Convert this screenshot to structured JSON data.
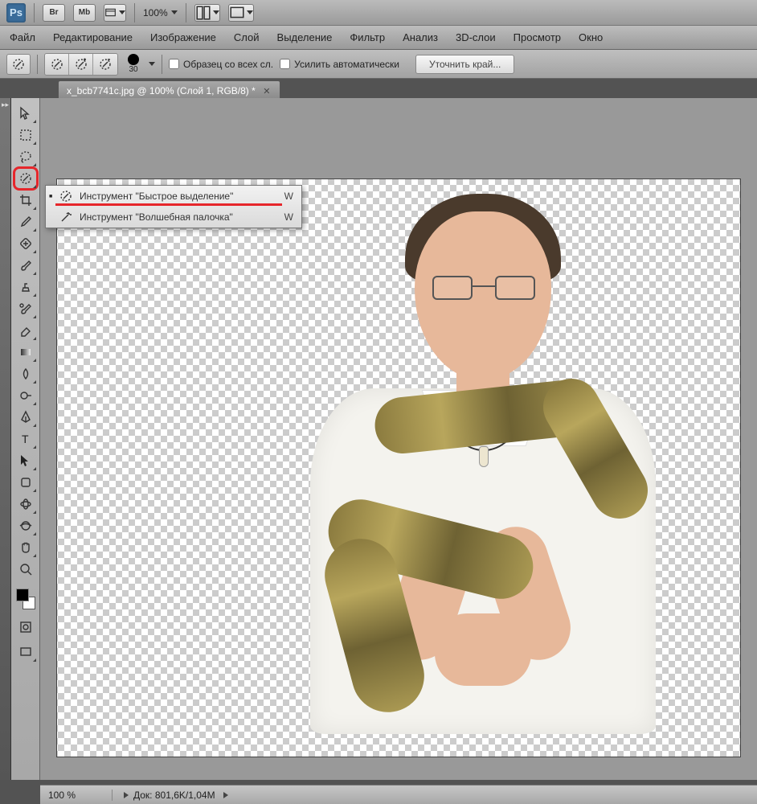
{
  "top": {
    "logo": "Ps",
    "br": "Br",
    "mb": "Mb",
    "zoom": "100%"
  },
  "menu": {
    "file": "Файл",
    "edit": "Редактирование",
    "image": "Изображение",
    "layer": "Слой",
    "select": "Выделение",
    "filter": "Фильтр",
    "analysis": "Анализ",
    "threeD": "3D-слои",
    "view": "Просмотр",
    "window": "Окно"
  },
  "options": {
    "brush_size": "30",
    "sample_all": "Образец со всех сл.",
    "auto_enhance": "Усилить автоматически",
    "refine_edge": "Уточнить край..."
  },
  "tab": {
    "title": "x_bcb7741c.jpg @ 100% (Слой 1, RGB/8) *"
  },
  "flyout": {
    "quick_select": "Инструмент \"Быстрое выделение\"",
    "magic_wand": "Инструмент \"Волшебная палочка\"",
    "key": "W"
  },
  "status": {
    "zoom": "100 %",
    "doc": "Док: 801,6K/1,04M"
  },
  "tools": [
    "move",
    "marquee",
    "lasso",
    "quick-selection",
    "crop",
    "eyedropper",
    "healing-brush",
    "brush",
    "clone-stamp",
    "history-brush",
    "eraser",
    "gradient",
    "blur",
    "dodge",
    "pen",
    "type",
    "path-selection",
    "shape",
    "3d-rotate",
    "3d-orbit",
    "hand",
    "zoom"
  ]
}
